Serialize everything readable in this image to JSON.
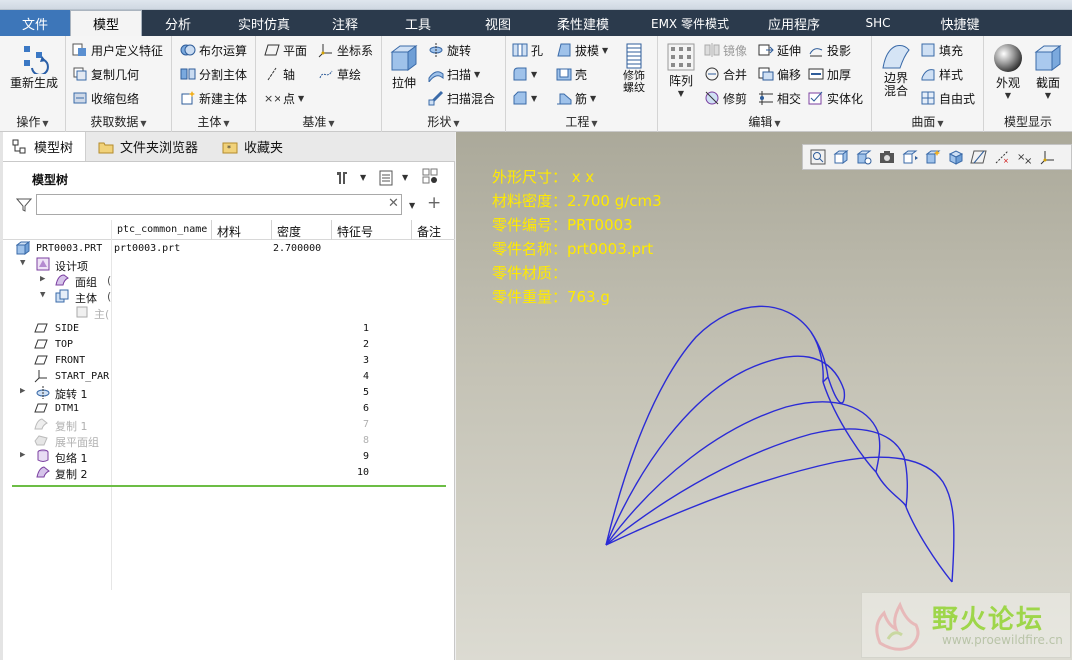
{
  "menu": {
    "tabs": [
      "文件",
      "模型",
      "分析",
      "实时仿真",
      "注释",
      "工具",
      "视图",
      "柔性建模",
      "EMX 零件模式",
      "应用程序",
      "SHC",
      "快捷键"
    ],
    "active": "模型"
  },
  "ribbon": {
    "operations": {
      "label": "操作",
      "regenerate": "重新生成"
    },
    "get_data": {
      "label": "获取数据",
      "udf": "用户定义特征",
      "copy_geometry": "复制几何",
      "shrinkwrap": "收缩包络"
    },
    "body": {
      "label": "主体",
      "boolean": "布尔运算",
      "split_body": "分割主体",
      "new_body": "新建主体"
    },
    "datum": {
      "label": "基准",
      "plane": "平面",
      "coordsys": "坐标系",
      "axis": "轴",
      "sketch": "草绘",
      "point": "点"
    },
    "shapes": {
      "label": "形状",
      "extrude": "拉伸",
      "revolve": "旋转",
      "sweep": "扫描",
      "swept_blend": "扫描混合"
    },
    "engineering": {
      "label": "工程",
      "hole": "孔",
      "draft": "拔模",
      "shell": "壳",
      "rib": "筋",
      "cosmetic_thread": "修饰螺纹"
    },
    "editing": {
      "label": "编辑",
      "pattern": "阵列",
      "mirror": "镜像",
      "extend": "延伸",
      "project": "投影",
      "merge": "合并",
      "offset": "偏移",
      "thicken": "加厚",
      "trim": "修剪",
      "intersect": "相交",
      "solidify": "实体化"
    },
    "surfaces": {
      "label": "曲面",
      "boundary_blend": "边界混合",
      "fill": "填充",
      "style": "样式",
      "freestyle": "自由式"
    },
    "display": {
      "label": "模型显示",
      "appearance": "外观",
      "section": "截面"
    }
  },
  "panel": {
    "tabs": [
      "模型树",
      "文件夹浏览器",
      "收藏夹"
    ],
    "tree_title": "模型树",
    "filter_value": "",
    "columns": [
      "ptc_common_name",
      "材料",
      "密度",
      "特征号",
      "备注"
    ],
    "rows": [
      {
        "name": "PRT0003.PRT",
        "common": "prt0003.prt",
        "density": "2.700000",
        "num": ""
      },
      {
        "name": "设计项",
        "num": ""
      },
      {
        "name": "面组",
        "suffix": "(",
        "num": ""
      },
      {
        "name": "主体",
        "suffix": "(",
        "num": ""
      },
      {
        "name": "主(",
        "num": ""
      },
      {
        "name": "SIDE",
        "num": "1"
      },
      {
        "name": "TOP",
        "num": "2"
      },
      {
        "name": "FRONT",
        "num": "3"
      },
      {
        "name": "START_PAR",
        "num": "4"
      },
      {
        "name": "旋转 1",
        "num": "5"
      },
      {
        "name": "DTM1",
        "num": "6"
      },
      {
        "name": "复制 1",
        "num": "7"
      },
      {
        "name": "展平面组",
        "num": "8"
      },
      {
        "name": "包络 1",
        "num": "9"
      },
      {
        "name": "复制 2",
        "num": "10"
      }
    ]
  },
  "canvas": {
    "info": [
      "外形尺寸： x x",
      "材料密度：2.700 g/cm3",
      "零件编号：PRT0003",
      "零件名称：prt0003.prt",
      "零件材质：",
      "零件重量：763.g"
    ],
    "watermark_title": "野火论坛",
    "watermark_url": "www.proewildfire.cn",
    "curve_color": "#2b2bd6",
    "info_color": "#ffea00"
  }
}
